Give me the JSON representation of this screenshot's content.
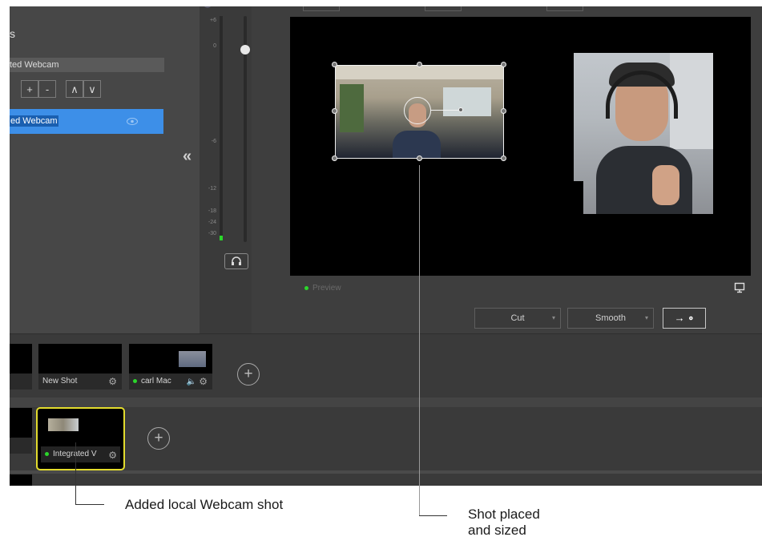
{
  "left_panel": {
    "heading": "s",
    "source_name_field": "ted Webcam",
    "buttons": {
      "add": "+",
      "remove": "-",
      "up": "∧",
      "down": "∨"
    },
    "source_row_label": "ed Webcam",
    "collapse_glyph": "«"
  },
  "audio": {
    "db_ticks": [
      "+6",
      "0",
      "-6",
      "-12",
      "-18",
      "-24",
      "-30"
    ],
    "level": 0.9
  },
  "preview": {
    "label": "Preview"
  },
  "transitions": {
    "cut_label": "Cut",
    "smooth_label": "Smooth",
    "go_label": "→ ∘"
  },
  "shots": {
    "row1": [
      {
        "label": "New Shot"
      },
      {
        "label": "carl Mac"
      }
    ],
    "row2": [
      {
        "label": "Integrated V"
      }
    ],
    "add_glyph": "+"
  },
  "annotations": {
    "left": "Added local Webcam shot",
    "right_line1": "Shot placed",
    "right_line2": "and sized"
  },
  "colors": {
    "selection_blue": "#3d8fe8",
    "live_green": "#2bd62b",
    "selected_shot_border": "#e3dc2d"
  }
}
